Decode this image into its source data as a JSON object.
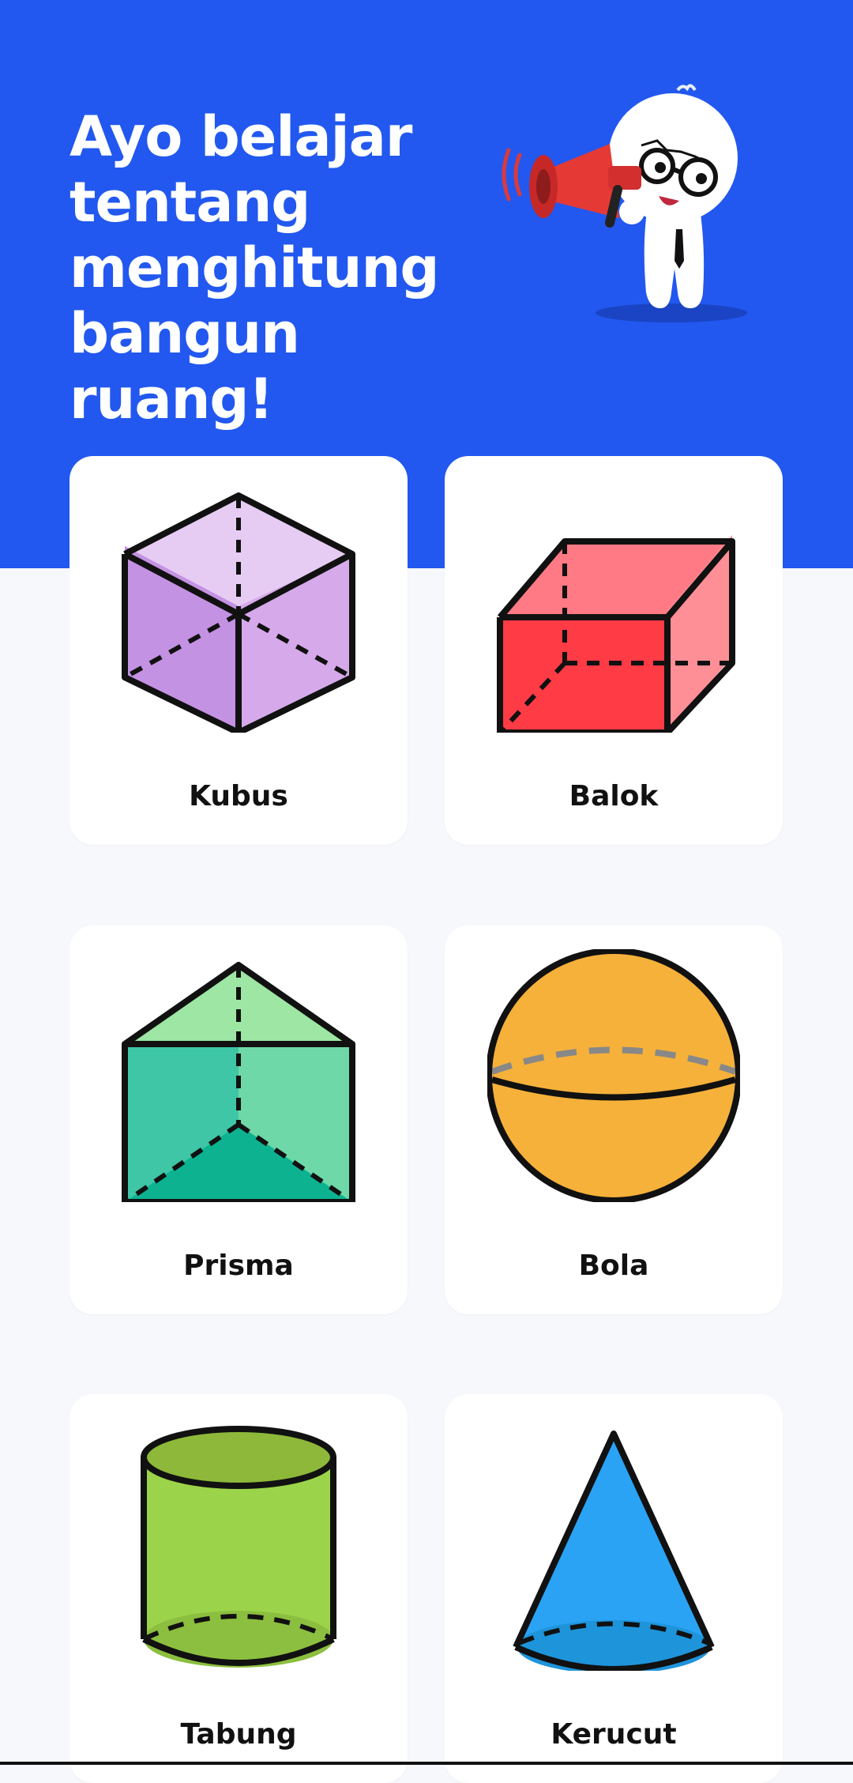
{
  "hero": {
    "title": "Ayo belajar tentang menghitung bangun ruang!",
    "background_color": "#2258ef",
    "illustration": "mascot-megaphone-icon"
  },
  "shapes": [
    {
      "label": "Kubus",
      "icon": "cube-icon",
      "color": "#c99ae6"
    },
    {
      "label": "Balok",
      "icon": "cuboid-icon",
      "color": "#ff4d5a"
    },
    {
      "label": "Prisma",
      "icon": "prism-icon",
      "color": "#3ec6a6"
    },
    {
      "label": "Bola",
      "icon": "sphere-icon",
      "color": "#f5b13a"
    },
    {
      "label": "Tabung",
      "icon": "cylinder-icon",
      "color": "#9bd44a"
    },
    {
      "label": "Kerucut",
      "icon": "cone-icon",
      "color": "#2aa3f5"
    }
  ]
}
